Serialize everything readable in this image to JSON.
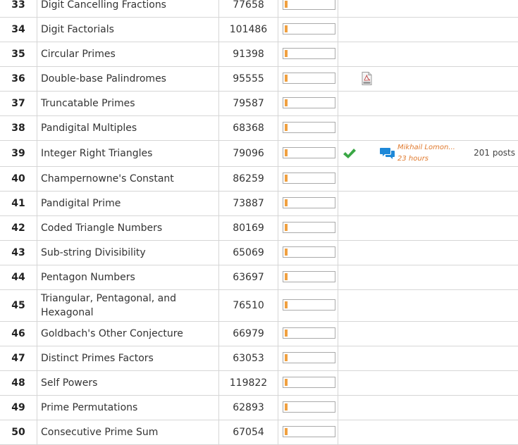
{
  "problems": [
    {
      "id": "33",
      "title": "Digit Cancelling Fractions",
      "solved": "77658",
      "difficulty_pct": 5
    },
    {
      "id": "34",
      "title": "Digit Factorials",
      "solved": "101486",
      "difficulty_pct": 5
    },
    {
      "id": "35",
      "title": "Circular Primes",
      "solved": "91398",
      "difficulty_pct": 5
    },
    {
      "id": "36",
      "title": "Double-base Palindromes",
      "solved": "95555",
      "difficulty_pct": 5,
      "has_pdf": true
    },
    {
      "id": "37",
      "title": "Truncatable Primes",
      "solved": "79587",
      "difficulty_pct": 5
    },
    {
      "id": "38",
      "title": "Pandigital Multiples",
      "solved": "68368",
      "difficulty_pct": 5
    },
    {
      "id": "39",
      "title": "Integer Right Triangles",
      "solved": "79096",
      "difficulty_pct": 5,
      "completed": true,
      "forum": {
        "user": "Mikhail Lomon...",
        "time": "23 hours",
        "posts": "201 posts"
      }
    },
    {
      "id": "40",
      "title": "Champernowne's Constant",
      "solved": "86259",
      "difficulty_pct": 5
    },
    {
      "id": "41",
      "title": "Pandigital Prime",
      "solved": "73887",
      "difficulty_pct": 5
    },
    {
      "id": "42",
      "title": "Coded Triangle Numbers",
      "solved": "80169",
      "difficulty_pct": 5
    },
    {
      "id": "43",
      "title": "Sub-string Divisibility",
      "solved": "65069",
      "difficulty_pct": 5
    },
    {
      "id": "44",
      "title": "Pentagon Numbers",
      "solved": "63697",
      "difficulty_pct": 5
    },
    {
      "id": "45",
      "title": "Triangular, Pentagonal, and Hexagonal",
      "solved": "76510",
      "difficulty_pct": 5
    },
    {
      "id": "46",
      "title": "Goldbach's Other Conjecture",
      "solved": "66979",
      "difficulty_pct": 5
    },
    {
      "id": "47",
      "title": "Distinct Primes Factors",
      "solved": "63053",
      "difficulty_pct": 5
    },
    {
      "id": "48",
      "title": "Self Powers",
      "solved": "119822",
      "difficulty_pct": 5
    },
    {
      "id": "49",
      "title": "Prime Permutations",
      "solved": "62893",
      "difficulty_pct": 5
    },
    {
      "id": "50",
      "title": "Consecutive Prime Sum",
      "solved": "67054",
      "difficulty_pct": 5
    }
  ],
  "icons": {
    "pdf": "pdf-file-icon",
    "check": "check-icon",
    "chat": "chat-bubbles-icon"
  },
  "colors": {
    "bar_fill": "#f0a040",
    "check": "#3aa745",
    "chat": "#1e88d8",
    "forum_text": "#e07a2e"
  }
}
